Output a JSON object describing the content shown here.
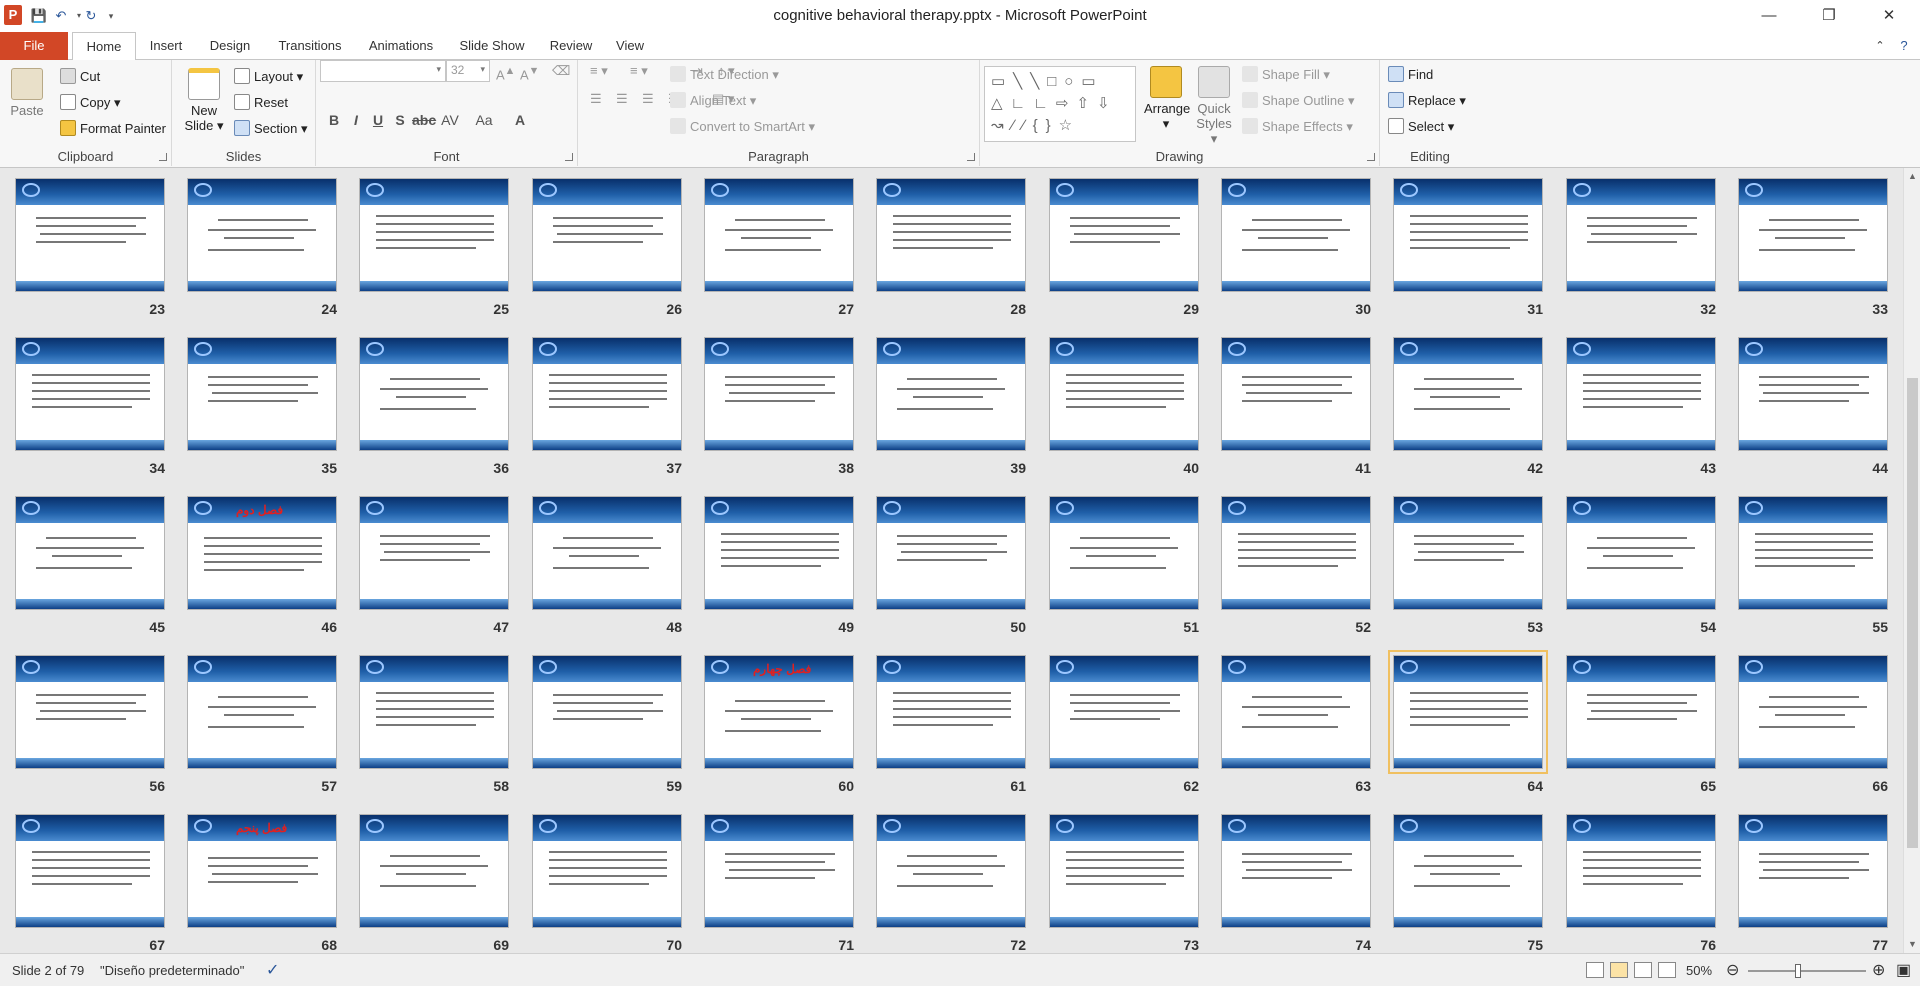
{
  "window": {
    "title": "cognitive behavioral therapy.pptx - Microsoft PowerPoint",
    "app_icon": "P"
  },
  "tabs": {
    "file": "File",
    "home": "Home",
    "insert": "Insert",
    "design": "Design",
    "transitions": "Transitions",
    "animations": "Animations",
    "slideshow": "Slide Show",
    "review": "Review",
    "view": "View"
  },
  "ribbon": {
    "clipboard": {
      "label": "Clipboard",
      "paste": "Paste",
      "cut": "Cut",
      "copy": "Copy",
      "format_painter": "Format Painter"
    },
    "slides": {
      "label": "Slides",
      "new_slide_1": "New",
      "new_slide_2": "Slide",
      "layout": "Layout",
      "reset": "Reset",
      "section": "Section"
    },
    "font": {
      "label": "Font",
      "size": "32"
    },
    "paragraph": {
      "label": "Paragraph",
      "text_direction": "Text Direction",
      "align_text": "Align Text",
      "convert_smartart": "Convert to SmartArt"
    },
    "drawing": {
      "label": "Drawing",
      "arrange": "Arrange",
      "quick_styles_1": "Quick",
      "quick_styles_2": "Styles",
      "shape_fill": "Shape Fill",
      "shape_outline": "Shape Outline",
      "shape_effects": "Shape Effects"
    },
    "editing": {
      "label": "Editing",
      "find": "Find",
      "replace": "Replace",
      "select": "Select"
    }
  },
  "slides": [
    {
      "n": "23"
    },
    {
      "n": "24"
    },
    {
      "n": "25"
    },
    {
      "n": "26"
    },
    {
      "n": "27"
    },
    {
      "n": "28"
    },
    {
      "n": "29"
    },
    {
      "n": "30"
    },
    {
      "n": "31"
    },
    {
      "n": "32"
    },
    {
      "n": "33"
    },
    {
      "n": "34"
    },
    {
      "n": "35"
    },
    {
      "n": "36"
    },
    {
      "n": "37"
    },
    {
      "n": "38"
    },
    {
      "n": "39"
    },
    {
      "n": "40"
    },
    {
      "n": "41"
    },
    {
      "n": "42"
    },
    {
      "n": "43"
    },
    {
      "n": "44"
    },
    {
      "n": "45"
    },
    {
      "n": "46",
      "heading": "فصل دوم"
    },
    {
      "n": "47"
    },
    {
      "n": "48"
    },
    {
      "n": "49"
    },
    {
      "n": "50"
    },
    {
      "n": "51"
    },
    {
      "n": "52"
    },
    {
      "n": "53"
    },
    {
      "n": "54"
    },
    {
      "n": "55"
    },
    {
      "n": "56"
    },
    {
      "n": "57"
    },
    {
      "n": "58"
    },
    {
      "n": "59"
    },
    {
      "n": "60",
      "heading": "فصل چهارم"
    },
    {
      "n": "61"
    },
    {
      "n": "62"
    },
    {
      "n": "63"
    },
    {
      "n": "64",
      "selected": true
    },
    {
      "n": "65"
    },
    {
      "n": "66"
    },
    {
      "n": "67"
    },
    {
      "n": "68",
      "heading": "فصل پنجم"
    },
    {
      "n": "69"
    },
    {
      "n": "70"
    },
    {
      "n": "71"
    },
    {
      "n": "72"
    },
    {
      "n": "73"
    },
    {
      "n": "74"
    },
    {
      "n": "75"
    },
    {
      "n": "76"
    },
    {
      "n": "77"
    }
  ],
  "status": {
    "slide_info": "Slide 2 of 79",
    "theme": "\"Diseño predeterminado\"",
    "zoom": "50%",
    "zoom_fraction": 0.42
  },
  "colors": {
    "accent": "#d24726",
    "slide_header": "#1f5fa8",
    "heading_red": "#e02020"
  }
}
